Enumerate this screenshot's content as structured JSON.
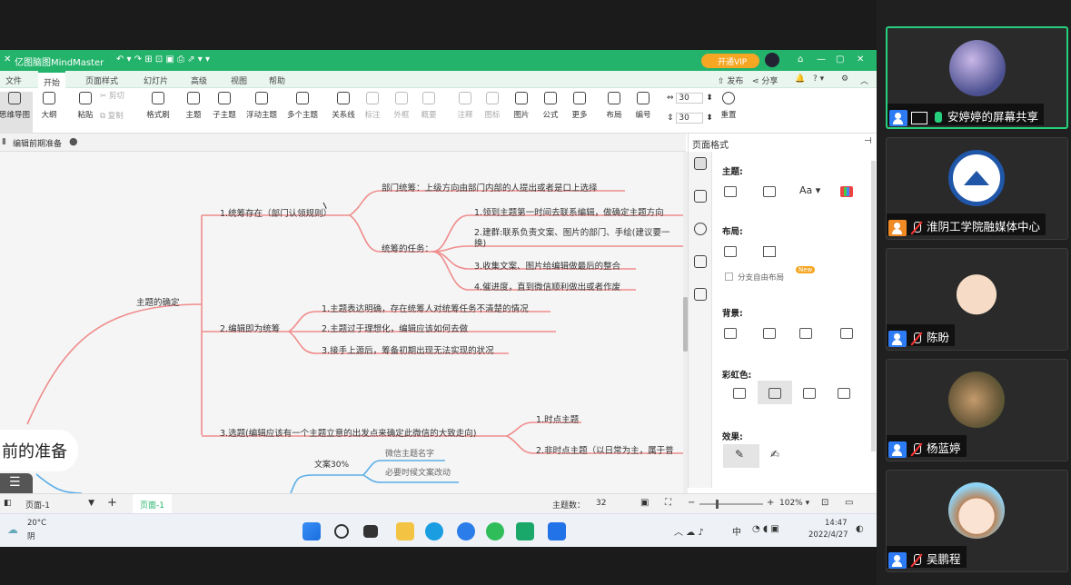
{
  "app": {
    "title": "亿图脑图MindMaster",
    "vip_button": "开通VIP",
    "publish": "发布",
    "share": "分享",
    "help_mark": "?",
    "menus": [
      "文件",
      "开始",
      "页面样式",
      "幻灯片",
      "高级",
      "视图",
      "帮助"
    ],
    "active_menu": "开始",
    "toolbar": [
      {
        "label": "思维导图",
        "icon": "mindmap-icon",
        "selected": true
      },
      {
        "label": "大纲",
        "icon": "outline-icon"
      },
      {
        "label": "粘贴",
        "icon": "paste-icon"
      },
      {
        "label": "剪切",
        "icon": "cut-icon",
        "dim": true
      },
      {
        "label": "复制",
        "icon": "copy-icon",
        "dim": true
      },
      {
        "label": "格式刷",
        "icon": "format-brush-icon"
      },
      {
        "label": "主题",
        "icon": "topic-icon"
      },
      {
        "label": "子主题",
        "icon": "subtopic-icon"
      },
      {
        "label": "浮动主题",
        "icon": "floating-topic-icon"
      },
      {
        "label": "多个主题",
        "icon": "multiple-topics-icon"
      },
      {
        "label": "关系线",
        "icon": "relationship-icon"
      },
      {
        "label": "标注",
        "icon": "callout-icon",
        "dim": true
      },
      {
        "label": "外框",
        "icon": "boundary-icon",
        "dim": true
      },
      {
        "label": "概要",
        "icon": "summary-icon",
        "dim": true
      },
      {
        "label": "注释",
        "icon": "note-icon",
        "dim": true
      },
      {
        "label": "图标",
        "icon": "mark-icon",
        "dim": true
      },
      {
        "label": "图片",
        "icon": "picture-icon"
      },
      {
        "label": "公式",
        "icon": "formula-icon"
      },
      {
        "label": "更多",
        "icon": "more-icon"
      },
      {
        "label": "布局",
        "icon": "layout-icon"
      },
      {
        "label": "编号",
        "icon": "numbering-icon"
      },
      {
        "label": "重置",
        "icon": "reset-icon"
      }
    ],
    "spacing_h": "30",
    "spacing_v": "30",
    "doc_tab": "编辑前期准备"
  },
  "mindmap": {
    "root": "前的准备",
    "main_branch": "主题的确定",
    "topics": [
      {
        "label": "1.统筹存在（部门认领规则）"
      },
      {
        "label": "2.编辑即为统筹"
      },
      {
        "label": "3.选题(编辑应该有一个主题立意的出发点来确定此微信的大致走向)"
      }
    ],
    "sub1": [
      "部门统筹：上级方向由部门内部的人提出或者是口上选择",
      "统筹的任务："
    ],
    "tasks": [
      "1.领到主题第一时间去联系编辑，做确定主题方向",
      "2.建群:联系负责文案、图片的部门、手绘(建议要一",
      "换)",
      "3.收集文案、图片给编辑做最后的整合",
      "4.催进度，直到微信顺利做出或者作废"
    ],
    "sub2": [
      "1.主题表达明确，存在统筹人对统筹任务不清楚的情况",
      "2.主题过于理想化，编辑应该如何去做",
      "3.接手上源后，筹备初期出现无法实现的状况"
    ],
    "sub3": [
      "1.时点主题",
      "2.非时点主题（以日常为主，属于普"
    ],
    "lower_branch": "文案30%",
    "lower_items": [
      "微信主题名字",
      "必要时候文案改动"
    ]
  },
  "panel": {
    "title": "页面格式",
    "theme_label": "主题:",
    "layout_label": "布局:",
    "free_layout": "分支自由布局",
    "new_badge": "New",
    "background_label": "背景:",
    "rainbow_label": "彩虹色:",
    "effect_label": "效果:"
  },
  "status": {
    "page_select": "页面-1",
    "page_tab": "页面-1",
    "topic_count_label": "主题数：",
    "topic_count": "32",
    "zoom": "102%"
  },
  "taskbar": {
    "temp": "20°C",
    "weather": "阴",
    "ime": "中",
    "time": "14:47",
    "date": "2022/4/27"
  },
  "participants": [
    {
      "name": "安婷婷的屏幕共享",
      "mic": "on",
      "screen_share": true,
      "active": true,
      "avatar_color": "#4a4f8e"
    },
    {
      "name": "淮阴工学院融媒体中心",
      "mic": "off",
      "avatar_color": "#1f56a8"
    },
    {
      "name": "陈盼",
      "mic": "off",
      "avatar_color": "#f3d7c0"
    },
    {
      "name": "杨蓝婷",
      "mic": "off",
      "avatar_color": "#6b5a3a"
    },
    {
      "name": "吴鹏程",
      "mic": "off",
      "avatar_color": "#8fd3f5"
    }
  ],
  "colors": {
    "brand_green": "#24b36b",
    "branch_red": "#f08c8c",
    "branch_blue": "#5aaee8",
    "vip_orange": "#f5a623",
    "active_border": "#26d07c"
  }
}
